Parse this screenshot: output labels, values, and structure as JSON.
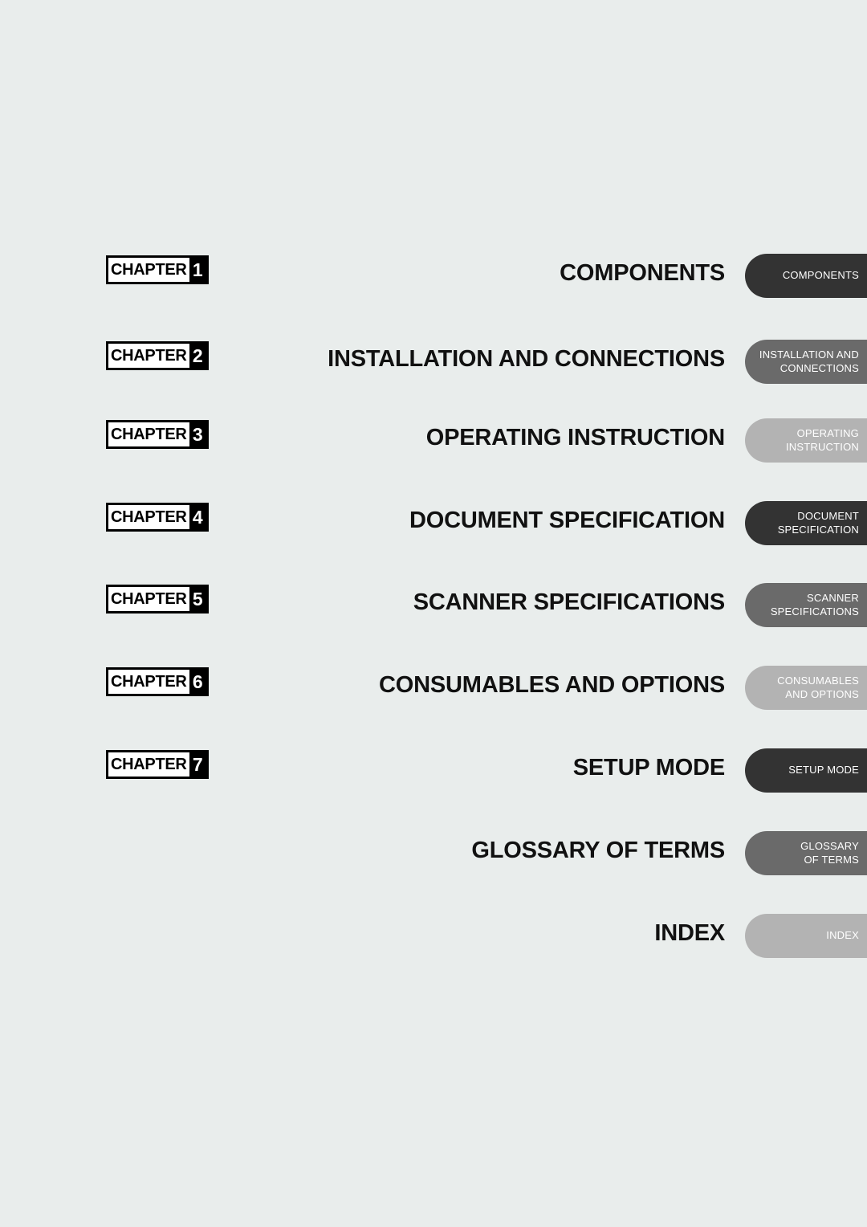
{
  "page": {
    "background_color": "#e9edec",
    "title_color": "#111111",
    "badge_word": "CHAPTER"
  },
  "tab_colors": {
    "dark": "#333333",
    "mid": "#6a6a6a",
    "light": "#b3b3b3"
  },
  "entries": [
    {
      "chapter_number": "1",
      "title": "COMPONENTS",
      "tab_lines": [
        "COMPONENTS"
      ],
      "tab_shade": "dark",
      "has_badge": true
    },
    {
      "chapter_number": "2",
      "title": "INSTALLATION AND CONNECTIONS",
      "tab_lines": [
        "INSTALLATION AND",
        "CONNECTIONS"
      ],
      "tab_shade": "mid",
      "has_badge": true
    },
    {
      "chapter_number": "3",
      "title": "OPERATING INSTRUCTION",
      "tab_lines": [
        "OPERATING",
        "INSTRUCTION"
      ],
      "tab_shade": "light",
      "has_badge": true
    },
    {
      "chapter_number": "4",
      "title": "DOCUMENT SPECIFICATION",
      "tab_lines": [
        "DOCUMENT",
        "SPECIFICATION"
      ],
      "tab_shade": "dark",
      "has_badge": true
    },
    {
      "chapter_number": "5",
      "title": "SCANNER SPECIFICATIONS",
      "tab_lines": [
        "SCANNER",
        "SPECIFICATIONS"
      ],
      "tab_shade": "mid",
      "has_badge": true
    },
    {
      "chapter_number": "6",
      "title": "CONSUMABLES AND OPTIONS",
      "tab_lines": [
        "CONSUMABLES",
        "AND OPTIONS"
      ],
      "tab_shade": "light",
      "has_badge": true
    },
    {
      "chapter_number": "7",
      "title": "SETUP MODE",
      "tab_lines": [
        "SETUP MODE"
      ],
      "tab_shade": "dark",
      "has_badge": true
    },
    {
      "chapter_number": "",
      "title": "GLOSSARY OF TERMS",
      "tab_lines": [
        "GLOSSARY",
        "OF TERMS"
      ],
      "tab_shade": "mid",
      "has_badge": false
    },
    {
      "chapter_number": "",
      "title": "INDEX",
      "tab_lines": [
        "INDEX"
      ],
      "tab_shade": "light",
      "has_badge": false
    }
  ]
}
